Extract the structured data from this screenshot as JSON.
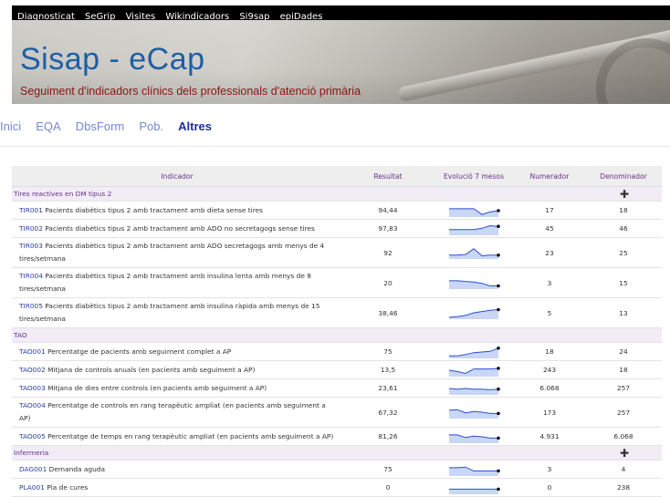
{
  "topnav": {
    "items": [
      "Diagnosticat",
      "SeGrip",
      "Visites",
      "Wikindicadors",
      "Si9sap",
      "epiDades"
    ]
  },
  "banner": {
    "title": "Sisap - eCap",
    "subtitle": "Seguiment d'indicadors clínics dels professionals d'atenció primària"
  },
  "mainnav": {
    "items": [
      {
        "label": "Inici",
        "active": false
      },
      {
        "label": "EQA",
        "active": false
      },
      {
        "label": "DbsForm",
        "active": false
      },
      {
        "label": "Pob.",
        "active": false
      },
      {
        "label": "Altres",
        "active": true
      }
    ]
  },
  "table": {
    "headers": {
      "indicador": "Indicador",
      "resultat": "Resultat",
      "evolucio": "Evolució 7 mesos",
      "numerador": "Numerador",
      "denominador": "Denominador"
    },
    "groups": [
      {
        "name": "Tires reactives en DM tipus 2",
        "plus": true,
        "rows": [
          {
            "code": "TIR001",
            "text": "Pacients diabètics tipus 2 amb tractament amb dieta sense tires",
            "resultat": "94,44",
            "numerador": "17",
            "denominador": "18",
            "spark": [
              0.35,
              0.35,
              0.35,
              0.35,
              0.8,
              0.6,
              0.5
            ]
          },
          {
            "code": "TIR002",
            "text": "Pacients diabètics tipus 2 amb tractament amb ADO no secretagogs sense tires",
            "resultat": "97,83",
            "numerador": "45",
            "denominador": "46",
            "spark": [
              0.55,
              0.55,
              0.55,
              0.55,
              0.45,
              0.25,
              0.3
            ]
          },
          {
            "code": "TIR003",
            "text": "Pacients diabètics tipus 2 amb tractament amb ADO secretagogs amb menys de 4 tires/setmana",
            "resultat": "92",
            "numerador": "23",
            "denominador": "25",
            "spark": [
              0.7,
              0.7,
              0.65,
              0.2,
              0.75,
              0.7,
              0.7
            ]
          },
          {
            "code": "TIR004",
            "text": "Pacients diabètics tipus 2 amb tractament amb insulina lenta amb menys de 8 tires/setmana",
            "resultat": "20",
            "numerador": "3",
            "denominador": "15",
            "spark": [
              0.35,
              0.35,
              0.4,
              0.45,
              0.55,
              0.75,
              0.75
            ]
          },
          {
            "code": "TIR005",
            "text": "Pacients diabètics tipus 2 amb tractament amb insulina ràpida amb menys de 15 tires/setmana",
            "resultat": "38,46",
            "numerador": "5",
            "denominador": "13",
            "spark": [
              0.85,
              0.8,
              0.7,
              0.5,
              0.4,
              0.3,
              0.25
            ]
          }
        ]
      },
      {
        "name": "TAO",
        "plus": false,
        "rows": [
          {
            "code": "TAO001",
            "text": "Percentatge de pacients amb seguiment complet a AP",
            "resultat": "75",
            "numerador": "18",
            "denominador": "24",
            "spark": [
              0.8,
              0.8,
              0.7,
              0.55,
              0.5,
              0.45,
              0.2
            ]
          },
          {
            "code": "TAO002",
            "text": "Mitjana de controls anuals (en pacients amb seguiment a AP)",
            "resultat": "13,5",
            "numerador": "243",
            "denominador": "18",
            "spark": [
              0.5,
              0.6,
              0.75,
              0.4,
              0.4,
              0.4,
              0.35
            ]
          },
          {
            "code": "TAO003",
            "text": "Mitjana de dies entre controls (en pacients amb seguiment a AP)",
            "resultat": "23,61",
            "numerador": "6.068",
            "denominador": "257",
            "spark": [
              0.5,
              0.55,
              0.5,
              0.55,
              0.55,
              0.6,
              0.55
            ]
          },
          {
            "code": "TAO004",
            "text": "Percentatge de controls en rang terapèutic ampliat (en pacients amb seguiment a AP)",
            "resultat": "67,32",
            "numerador": "173",
            "denominador": "257",
            "spark": [
              0.35,
              0.3,
              0.55,
              0.45,
              0.5,
              0.6,
              0.6
            ]
          },
          {
            "code": "TAO005",
            "text": "Percentatge de temps en rang terapèutic ampliat (en pacients amb seguiment a AP)",
            "resultat": "81,26",
            "numerador": "4.931",
            "denominador": "6.068",
            "spark": [
              0.35,
              0.35,
              0.55,
              0.45,
              0.5,
              0.6,
              0.6
            ]
          }
        ]
      },
      {
        "name": "Infermeria",
        "plus": true,
        "rows": [
          {
            "code": "DAG001",
            "text": "Demanda aguda",
            "resultat": "75",
            "numerador": "3",
            "denominador": "4",
            "spark": [
              0.35,
              0.35,
              0.3,
              0.6,
              0.6,
              0.6,
              0.6
            ]
          },
          {
            "code": "PLA001",
            "text": "Pla de cures",
            "resultat": "0",
            "numerador": "0",
            "denominador": "238",
            "spark": [
              0.6,
              0.6,
              0.6,
              0.6,
              0.6,
              0.6,
              0.6
            ]
          }
        ]
      }
    ]
  },
  "colors": {
    "spark_line": "#2b4fd1",
    "spark_fill": "#c9d6f5",
    "group_text": "#6a2f8a",
    "code_link": "#2a3fa0"
  }
}
